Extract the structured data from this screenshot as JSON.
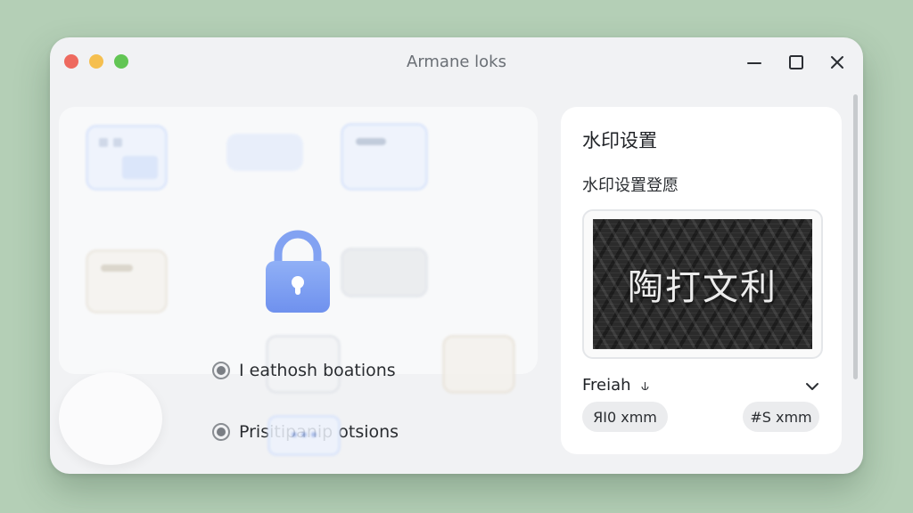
{
  "window": {
    "title": "Armane loks"
  },
  "left_panel": {
    "options": [
      {
        "label": "I eathosh boations",
        "selected": false
      },
      {
        "label": "Prisitipanip otsions",
        "selected": false
      }
    ],
    "lock_icon": "padlock-icon"
  },
  "right_panel": {
    "title": "水印设置",
    "subtitle": "水印设置登愿",
    "preview_text": "陶打文利",
    "font": {
      "label": "Freiah",
      "glyph": "⫝"
    },
    "pills": [
      "ЯІ0 xmm",
      "#S xmm"
    ]
  },
  "colors": {
    "background": "#b4cfb6",
    "window": "#f1f2f4",
    "lock_accent": "#7b9df2"
  }
}
